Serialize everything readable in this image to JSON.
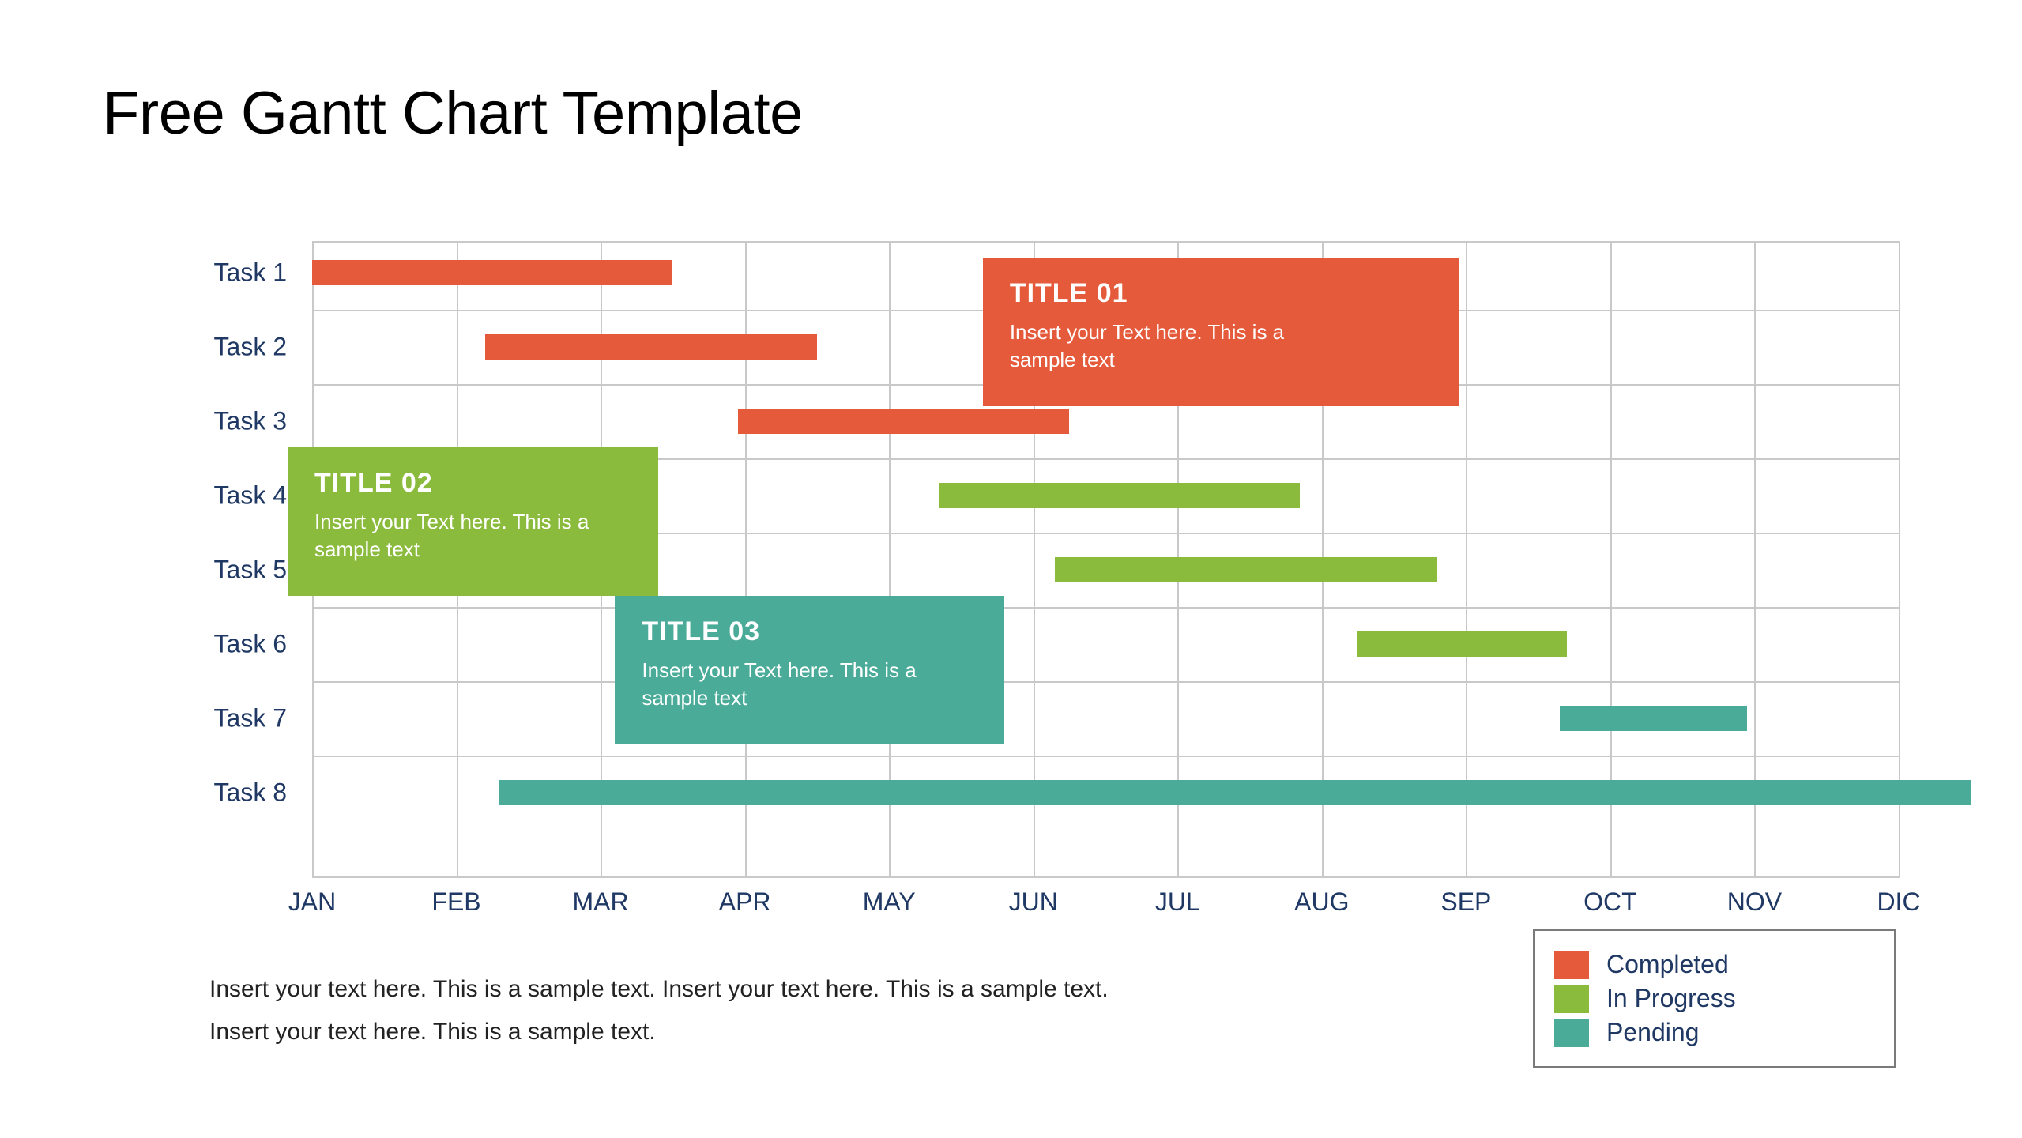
{
  "title": "Free Gantt Chart Template",
  "footer_lines": [
    "Insert your text here. This is a sample text. Insert your text here. This is a sample text.",
    "Insert your text here. This is a sample text."
  ],
  "legend": [
    {
      "label": "Completed",
      "color": "#e55a3a"
    },
    {
      "label": "In Progress",
      "color": "#8bbb3d"
    },
    {
      "label": "Pending",
      "color": "#4aab98"
    }
  ],
  "callouts": [
    {
      "id": "title-01",
      "title": "TITLE 01",
      "body": "Insert your Text here. This is a sample text",
      "color": "#e55a3a",
      "x0": 4.65,
      "x1": 7.95,
      "y0": 0.3,
      "y1": 2.3
    },
    {
      "id": "title-02",
      "title": "TITLE 02",
      "body": "Insert your Text here. This is a sample text",
      "color": "#8bbb3d",
      "x0": -0.17,
      "x1": 2.4,
      "y0": 2.85,
      "y1": 4.85
    },
    {
      "id": "title-03",
      "title": "TITLE 03",
      "body": "Insert your Text here. This is a sample text",
      "color": "#4aab98",
      "x0": 2.1,
      "x1": 4.8,
      "y0": 4.85,
      "y1": 6.85
    }
  ],
  "chart_data": {
    "type": "gantt",
    "title": "Free Gantt Chart Template",
    "categories": [
      "JAN",
      "FEB",
      "MAR",
      "APR",
      "MAY",
      "JUN",
      "JUL",
      "AUG",
      "SEP",
      "OCT",
      "NOV",
      "DIC"
    ],
    "rows": [
      "Task 1",
      "Task 2",
      "Task 3",
      "Task 4",
      "Task 5",
      "Task 6",
      "Task 7",
      "Task 8"
    ],
    "series_colors": {
      "Completed": "#e55a3a",
      "In Progress": "#8bbb3d",
      "Pending": "#4aab98"
    },
    "tasks": [
      {
        "row": "Task 1",
        "status": "Completed",
        "start": 0.0,
        "end": 2.5
      },
      {
        "row": "Task 2",
        "status": "Completed",
        "start": 1.2,
        "end": 3.5
      },
      {
        "row": "Task 3",
        "status": "Completed",
        "start": 2.95,
        "end": 5.25
      },
      {
        "row": "Task 4",
        "status": "In Progress",
        "start": 4.35,
        "end": 6.85
      },
      {
        "row": "Task 5",
        "status": "In Progress",
        "start": 5.15,
        "end": 7.8
      },
      {
        "row": "Task 6",
        "status": "In Progress",
        "start": 7.25,
        "end": 8.7
      },
      {
        "row": "Task 7",
        "status": "Pending",
        "start": 8.65,
        "end": 9.95
      },
      {
        "row": "Task 8",
        "status": "Pending",
        "start": 1.3,
        "end": 11.5
      }
    ],
    "xlabel": "",
    "ylabel": "",
    "x_range": [
      0,
      11
    ],
    "notes": "start/end are month-index positions along the JAN(0)..DIC(11) axis; fractional = within-month position."
  }
}
